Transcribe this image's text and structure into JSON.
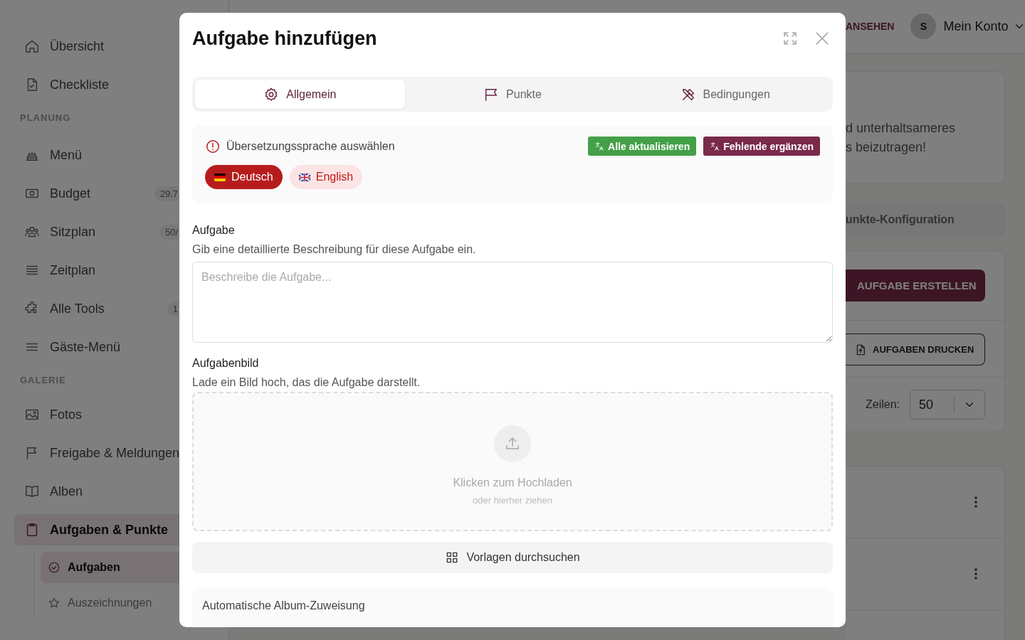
{
  "sidebar": {
    "groups": [
      {
        "items": [
          {
            "label": "Übersicht",
            "selected": false
          },
          {
            "label": "Checkliste",
            "selected": false
          }
        ]
      },
      {
        "heading": "PLANUNG",
        "items": [
          {
            "label": "Menü",
            "selected": false
          },
          {
            "label": "Budget",
            "badge": "29.7",
            "selected": false
          },
          {
            "label": "Sitzplan",
            "badge": "50/",
            "selected": false
          },
          {
            "label": "Zeitplan",
            "selected": false
          },
          {
            "label": "Alle Tools",
            "badge": "1",
            "selected": false
          },
          {
            "label": "Gäste-Menü",
            "selected": false
          }
        ]
      },
      {
        "heading": "GALERIE",
        "items": [
          {
            "label": "Fotos",
            "selected": false
          },
          {
            "label": "Freigabe & Meldungen",
            "selected": false
          },
          {
            "label": "Alben",
            "selected": false
          },
          {
            "label": "Aufgaben & Punkte",
            "selected": true,
            "children": [
              {
                "label": "Aufgaben",
                "selected": true
              },
              {
                "label": "Auszeichnungen",
                "selected": false
              }
            ]
          }
        ]
      }
    ]
  },
  "header": {
    "link": "ANSEHEN",
    "avatar": "S",
    "account": "Mein Konto"
  },
  "background": {
    "intro_lines": [
      "d unterhaltsameres",
      "s beizutragen!"
    ],
    "section_tab": "unkte-Konfiguration",
    "create_button": "AUFGABE ERSTELLEN",
    "print_button": "AUFGABEN DRUCKEN",
    "rows_label": "Zeilen:",
    "rows_value": "50"
  },
  "dialog": {
    "title": "Aufgabe hinzufügen",
    "tabs": [
      {
        "label": "Allgemein",
        "selected": true
      },
      {
        "label": "Punkte",
        "selected": false
      },
      {
        "label": "Bedingungen",
        "selected": false
      }
    ],
    "translation": {
      "heading": "Übersetzungssprache auswählen",
      "update_all": "Alle aktualisieren",
      "fill_missing": "Fehlende ergänzen",
      "languages": [
        {
          "label": "Deutsch",
          "selected": true
        },
        {
          "label": "English",
          "selected": false
        }
      ]
    },
    "task": {
      "label": "Aufgabe",
      "hint": "Gib eine detaillierte Beschreibung für diese Aufgabe ein.",
      "placeholder": "Beschreibe die Aufgabe..."
    },
    "image": {
      "label": "Aufgabenbild",
      "hint": "Lade ein Bild hoch, das die Aufgabe darstellt.",
      "upload_title": "Klicken zum Hochladen",
      "upload_hint": "oder hierher ziehen"
    },
    "templates_button": "Vorlagen durchsuchen",
    "album": {
      "heading": "Automatische Album-Zuweisung"
    }
  }
}
